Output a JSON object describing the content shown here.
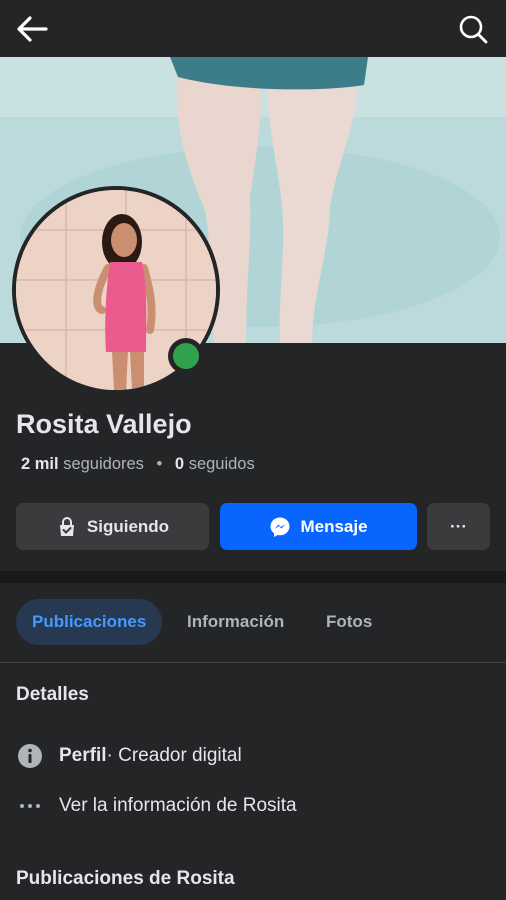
{
  "header": {
    "back_icon": "arrow-left-icon",
    "search_icon": "search-icon"
  },
  "profile": {
    "name": "Rosita Vallejo",
    "followers_count": "2 mil",
    "followers_label": "seguidores",
    "separator": "•",
    "following_count": "0",
    "following_label": "seguidos",
    "online_status_color": "#31a24c"
  },
  "actions": {
    "following_label": "Siguiendo",
    "message_label": "Mensaje",
    "more_label": "···",
    "message_color": "#0866ff"
  },
  "tabs": [
    {
      "label": "Publicaciones",
      "active": true
    },
    {
      "label": "Información",
      "active": false
    },
    {
      "label": "Fotos",
      "active": false
    }
  ],
  "details": {
    "title": "Detalles",
    "profile_label": "Perfil",
    "profile_value": " · Creador digital",
    "see_info": "Ver la información de Rosita"
  },
  "posts": {
    "title": "Publicaciones de Rosita"
  }
}
